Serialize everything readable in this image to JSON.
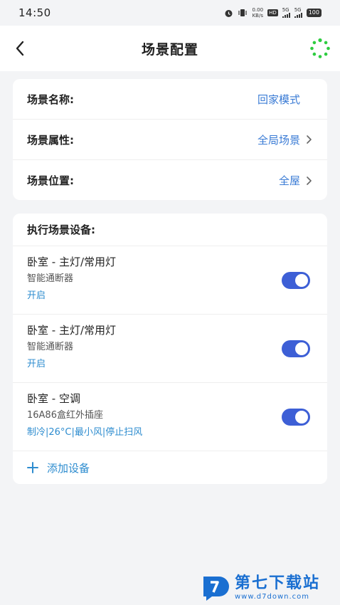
{
  "status_bar": {
    "time": "14:50",
    "net_speed_value": "0.00",
    "net_speed_unit": "KB/s",
    "hd_badge": "HD",
    "sim1_label": "5G",
    "sim2_label": "5G",
    "battery": "100"
  },
  "nav": {
    "title": "场景配置"
  },
  "scene": {
    "rows": [
      {
        "label": "场景名称:",
        "value": "回家模式"
      },
      {
        "label": "场景属性:",
        "value": "全局场景"
      },
      {
        "label": "场景位置:",
        "value": "全屋"
      }
    ]
  },
  "devices_section": {
    "title": "执行场景设备:",
    "items": [
      {
        "name": "卧室 - 主灯/常用灯",
        "type": "智能通断器",
        "action": "开启",
        "enabled": true
      },
      {
        "name": "卧室 - 主灯/常用灯",
        "type": "智能通断器",
        "action": "开启",
        "enabled": true
      },
      {
        "name": "卧室 - 空调",
        "type": "16A86盒红外插座",
        "action": "制冷|26°C|最小风|停止扫风",
        "enabled": true
      }
    ],
    "add_label": "添加设备"
  },
  "watermark": {
    "title": "第七下载站",
    "url": "www.d7down.com"
  },
  "colors": {
    "accent_blue": "#3a7bd5",
    "toggle_blue": "#3d5fd6",
    "action_blue": "#2d8ccf",
    "loading_green": "#2ecc40"
  }
}
